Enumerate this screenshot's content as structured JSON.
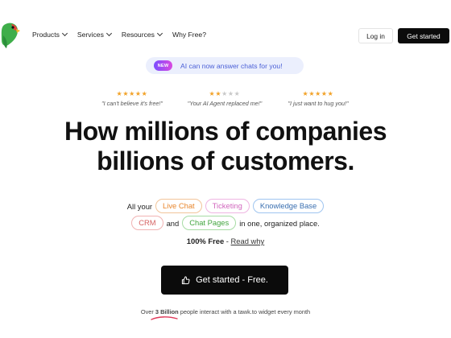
{
  "nav": {
    "logo_icon": "parrot-logo-icon",
    "menu": [
      {
        "label": "Products",
        "has_dropdown": true
      },
      {
        "label": "Services",
        "has_dropdown": true
      },
      {
        "label": "Resources",
        "has_dropdown": true
      },
      {
        "label": "Why Free?",
        "has_dropdown": false
      }
    ],
    "login_label": "Log in",
    "get_started_label": "Get started"
  },
  "announcement": {
    "badge": "NEW",
    "text": "AI can now answer chats for you!"
  },
  "reviews": [
    {
      "rating": 5,
      "quote": "\"I can't believe it's free!\""
    },
    {
      "rating": 2,
      "quote": "\"Your AI Agent replaced me!\""
    },
    {
      "rating": 5,
      "quote": "\"I just want to hug you!\""
    }
  ],
  "hero": {
    "headline_line1": "How millions of companies",
    "headline_line2": "billions of customers."
  },
  "features": {
    "prefix": "All your",
    "tags": [
      "Live Chat",
      "Ticketing",
      "Knowledge Base",
      "CRM",
      "Chat Pages"
    ],
    "and_word": "and",
    "suffix": "in one, organized place."
  },
  "free_line": {
    "bold": "100% Free",
    "separator": " - ",
    "link": "Read why"
  },
  "cta": {
    "label": "Get started - Free.",
    "icon": "thumbs-up-icon"
  },
  "stats": {
    "before": "Over ",
    "highlight": "3 Billion",
    "after": " people interact with a tawk.to widget every month"
  },
  "colors": {
    "accent_dark": "#0b0b0b",
    "pill_bg": "#ebeffd",
    "pill_text": "#4a5fd6",
    "star": "#f2a126"
  }
}
